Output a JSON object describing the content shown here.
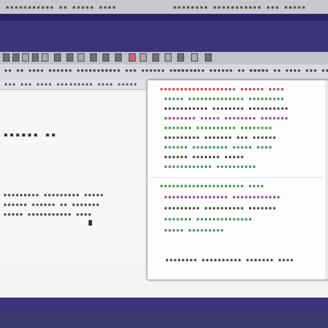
{
  "top_bar": {
    "left_text": "▪▪▪▪▪▪▪▪▪▪▪ ▪▪ ▪▪▪▪▪ ▪▪▪▪▪▪",
    "right_text": "▪▪▪▪▪▪▪▪ ▪▪▪▪▪▪▪▪▪▪▪ ▪▪▪ ▪▪▪▪▪"
  },
  "toolbar": {
    "item_1": "▪▪ ▪▪ ▪▪▪▪ ▪▪▪▪▪▪ ▪▪▪▪▪ ▪▪▪▪",
    "item_2": "▪▪▪▪▪▪ ▪▪▪ ▪▪▪▪▪▪ ▪▪▪▪▪▪▪",
    "item_3": "▪▪▪▪ ▪▪▪ ▪▪▪▪▪▪ ▪▪ ▪▪▪▪",
    "item_4": "▪▪▪▪▪ ▪▪ ▪▪▪▪ ▪▪▪ ▪▪▪▪"
  },
  "strip3": {
    "left": "▪▪▪ ▪▪▪ ▪▪▪▪ ▪▪▪",
    "right": "▪▪▪▪▪▪ ▪▪▪▪ ▪▪▪▪▪"
  },
  "left_pane": {
    "heading": "▪▪▪▪▪▪ ▪▪",
    "line_1": "▪▪▪▪▪▪▪▪▪ ▪▪▪▪▪▪▪▪▪ ▪▪▪▪▪",
    "line_2": "▪▪▪▪▪▪ ▪▪▪▪▪▪ ▪▪ ▪▪▪▪▪▪▪",
    "line_3": "▪▪▪▪▪ ▪▪▪▪▪▪▪▪▪▪▪ ▪▪▪▪"
  },
  "panel": {
    "lines": [
      {
        "text": "▪▪▪▪▪▪▪▪▪▪▪▪▪▪▪▪▪▪▪ ▪▪▪▪▪▪ ▪▪▪▪",
        "color": "#cc3333"
      },
      {
        "text": "▪▪▪▪▪ ▪▪▪▪▪▪▪▪▪▪▪▪▪▪ ▪▪▪▪▪▪▪▪▪",
        "color": "#2e8f3e"
      },
      {
        "text": "▪▪▪▪▪▪▪▪▪▪▪ ▪▪▪▪▪▪▪▪ ▪▪▪▪▪▪▪▪▪▪",
        "color": "#3a3a3e"
      },
      {
        "text": "▪▪▪▪▪▪▪▪ ▪▪▪▪▪ ▪▪▪▪▪▪▪▪ ▪▪▪▪▪▪▪",
        "color": "#9a2fa6"
      },
      {
        "text": "▪▪▪▪▪▪▪ ▪▪▪▪▪▪▪▪▪▪ ▪▪▪▪▪▪▪▪",
        "color": "#2e8f3e"
      },
      {
        "text": "▪▪▪▪▪▪▪▪▪ ▪▪▪▪▪▪▪ ▪▪▪ ▪▪▪▪▪▪",
        "color": "#3a3a3e"
      },
      {
        "text": "▪▪▪▪▪▪ ▪▪▪▪▪▪▪▪▪ ▪▪▪▪▪ ▪▪▪▪",
        "color": "#2e8f3e"
      },
      {
        "text": "▪▪▪▪▪▪ ▪▪▪▪▪▪▪ ▪▪▪▪▪",
        "color": "#3a3a3e"
      },
      {
        "text": "▪▪▪▪▪▪▪▪▪▪▪▪ ▪▪▪▪▪▪▪▪▪▪",
        "color": "#2e8f3e"
      }
    ],
    "lines_b": [
      {
        "text": "▪▪▪▪▪▪▪▪▪▪▪▪▪▪▪▪▪▪▪▪▪ ▪▪▪▪",
        "color": "#2e8f3e"
      },
      {
        "text": "▪▪▪▪▪▪▪▪▪▪▪▪▪▪▪▪ ▪▪▪▪▪▪▪▪▪▪▪▪",
        "color": "#9a2fa6"
      },
      {
        "text": "▪▪▪▪▪▪▪▪▪ ▪▪▪▪▪▪▪▪▪▪ ▪▪▪▪▪▪▪",
        "color": "#3a3a3e"
      },
      {
        "text": "▪▪▪▪▪▪▪ ▪▪▪▪▪▪▪▪▪▪▪▪▪▪",
        "color": "#2e8f3e"
      },
      {
        "text": "▪▪▪▪▪ ▪▪▪▪▪▪▪▪▪",
        "color": "#2e8f3e"
      }
    ],
    "status_text": "▪▪▪▪▪▪▪▪ ▪▪▪▪▪▪▪▪▪▪ ▪▪▪▪▪▪▪ ▪▪▪▪"
  },
  "colors": {
    "desktop_background": "#3a3478",
    "accent_pink": "#d0607a"
  }
}
